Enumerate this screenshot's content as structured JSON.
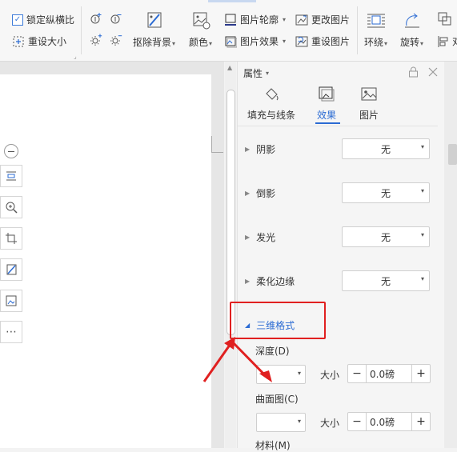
{
  "ribbon": {
    "lock_ratio_label": "锁定纵横比",
    "reset_size_label": "重设大小",
    "remove_bg_label": "抠除背景",
    "color_label": "颜色",
    "outline_label": "图片轮廓",
    "effects_label": "图片效果",
    "change_pic_label": "更改图片",
    "reset_pic_label": "重设图片",
    "wrap_label": "环绕",
    "rotate_label": "旋转",
    "align_label": "对"
  },
  "panel": {
    "title": "属性",
    "tabs": [
      {
        "label": "填充与线条",
        "icon": "fill-bucket-icon"
      },
      {
        "label": "效果",
        "icon": "effects-icon"
      },
      {
        "label": "图片",
        "icon": "picture-icon"
      }
    ],
    "sections": [
      {
        "label": "阴影",
        "value": "无"
      },
      {
        "label": "倒影",
        "value": "无"
      },
      {
        "label": "发光",
        "value": "无"
      },
      {
        "label": "柔化边缘",
        "value": "无"
      }
    ],
    "format3d": {
      "label": "三维格式",
      "depth_label": "深度(D)",
      "size_label": "大小",
      "depth_value": "0.0磅",
      "contour_label": "曲面图(C)",
      "contour_size_label": "大小",
      "contour_value": "0.0磅",
      "material_label": "材料(M)"
    },
    "accent_color": "#2b6bd3",
    "highlight_color": "#e02020"
  }
}
